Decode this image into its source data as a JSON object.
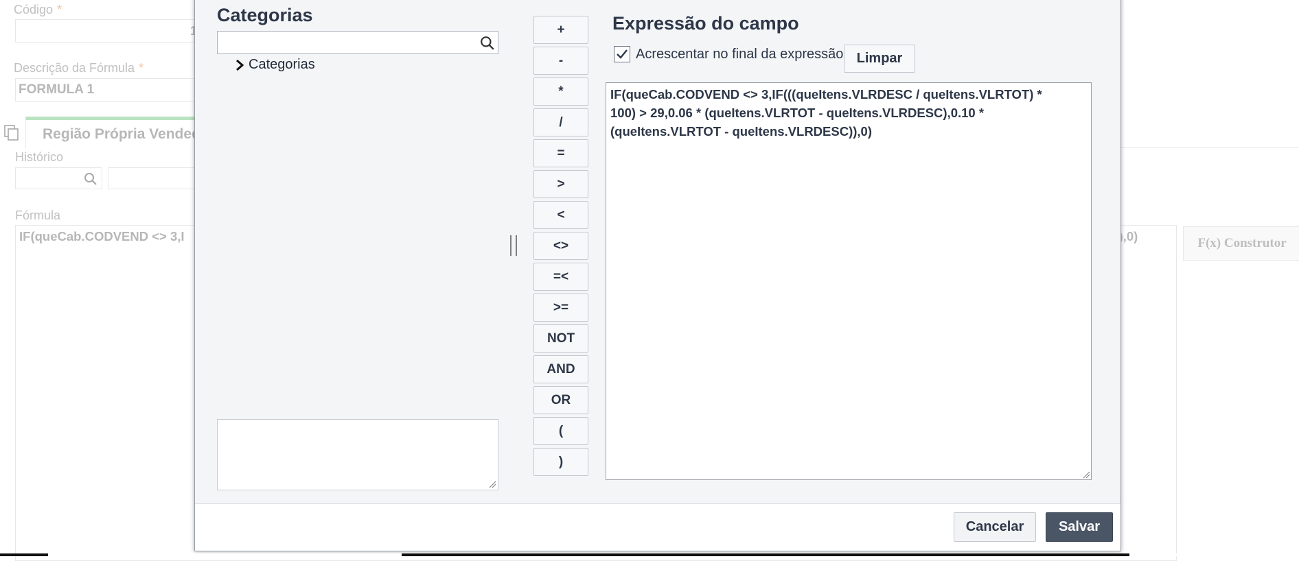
{
  "background_form": {
    "codigo_label": "Código",
    "required_mark": "*",
    "codigo_value": "1",
    "descricao_label": "Descrição da Fórmula",
    "descricao_value": "FORMULA 1",
    "tab_label": "Região Própria Vended",
    "historico_label": "Histórico",
    "formula_label": "Fórmula",
    "formula_left_text": "IF(queCab.CODVEND <> 3,I",
    "formula_right_text": "C)),0)",
    "fx_button_label": "F(x) Construtor"
  },
  "modal": {
    "categories_title": "Categorias",
    "category_search_placeholder": "",
    "tree_root_label": "Categorias",
    "operators": [
      "+",
      "-",
      "*",
      "/",
      "=",
      ">",
      "<",
      "<>",
      "=<",
      ">=",
      "NOT",
      "AND",
      "OR",
      "(",
      ")"
    ],
    "expression_title": "Expressão do campo",
    "append_checkbox_label": "Acrescentar no final da expressão",
    "append_checked": true,
    "clear_button_label": "Limpar",
    "expression_text": "IF(queCab.CODVEND <> 3,IF(((queItens.VLRDESC / queItens.VLRTOT) *\n100) > 29,0.06 * (queItens.VLRTOT - queItens.VLRDESC),0.10 *\n(queItens.VLRTOT - queItens.VLRDESC)),0)",
    "cancel_label": "Cancelar",
    "save_label": "Salvar"
  },
  "colors": {
    "save_button_bg": "#4a5566",
    "tab_accent": "#5cc06a",
    "required_mark": "#e0702a"
  }
}
